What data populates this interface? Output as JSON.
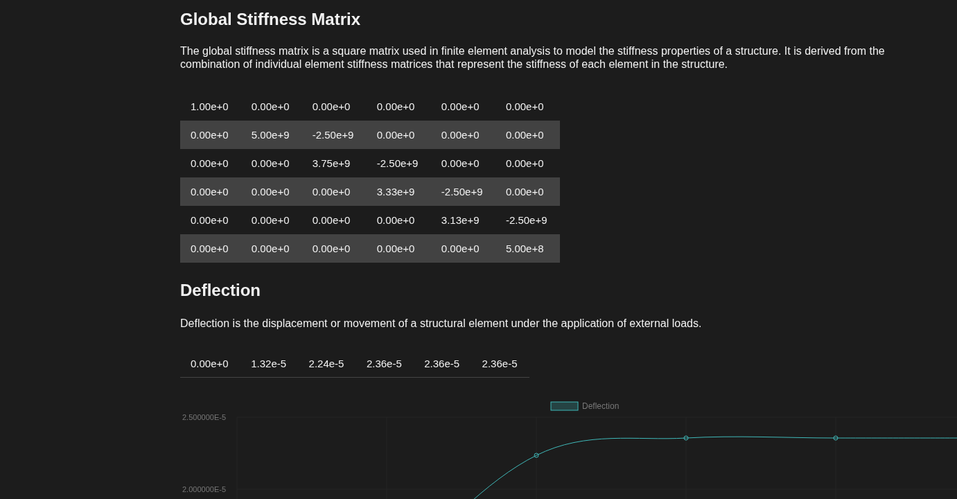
{
  "stiffness": {
    "title": "Global Stiffness Matrix",
    "description": "The global stiffness matrix is a square matrix used in finite element analysis to model the stiffness properties of a structure. It is derived from the combination of individual element stiffness matrices that represent the stiffness of each element in the structure.",
    "rows": [
      [
        "1.00e+0",
        "0.00e+0",
        "0.00e+0",
        "0.00e+0",
        "0.00e+0",
        "0.00e+0"
      ],
      [
        "0.00e+0",
        "5.00e+9",
        "-2.50e+9",
        "0.00e+0",
        "0.00e+0",
        "0.00e+0"
      ],
      [
        "0.00e+0",
        "0.00e+0",
        "3.75e+9",
        "-2.50e+9",
        "0.00e+0",
        "0.00e+0"
      ],
      [
        "0.00e+0",
        "0.00e+0",
        "0.00e+0",
        "3.33e+9",
        "-2.50e+9",
        "0.00e+0"
      ],
      [
        "0.00e+0",
        "0.00e+0",
        "0.00e+0",
        "0.00e+0",
        "3.13e+9",
        "-2.50e+9"
      ],
      [
        "0.00e+0",
        "0.00e+0",
        "0.00e+0",
        "0.00e+0",
        "0.00e+0",
        "5.00e+8"
      ]
    ]
  },
  "deflection": {
    "title": "Deflection",
    "description": "Deflection is the displacement or movement of a structural element under the application of external loads.",
    "values": [
      "0.00e+0",
      "1.32e-5",
      "2.24e-5",
      "2.36e-5",
      "2.36e-5",
      "2.36e-5"
    ],
    "chart": {
      "legend": "Deflection",
      "y_axis_labels": [
        "2.500000E-5",
        "2.000000E-5"
      ]
    }
  }
}
